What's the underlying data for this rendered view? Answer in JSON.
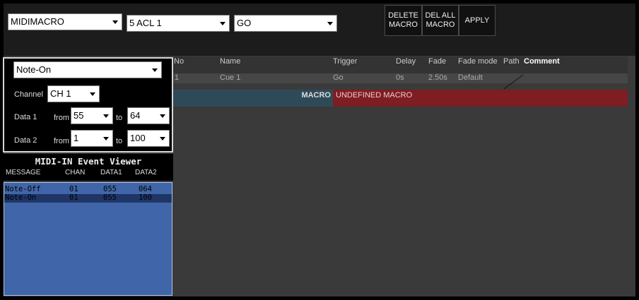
{
  "toolbar": {
    "macro_type": "MIDIMACRO",
    "cue_list": "5 ACL 1",
    "action": "GO",
    "delete_macro": "DELETE\nMACRO",
    "delete_all_macro": "DEL ALL\nMACRO",
    "apply": "APPLY"
  },
  "filter": {
    "message_type": "Note-On",
    "channel_label": "Channel",
    "channel_value": "CH 1",
    "data1_label": "Data 1",
    "data1_from_label": "from",
    "data1_from": "55",
    "data1_to_label": "to",
    "data1_to": "64",
    "data2_label": "Data 2",
    "data2_from_label": "from",
    "data2_from": "1",
    "data2_to_label": "to",
    "data2_to": "100"
  },
  "viewer": {
    "title": "MIDI-IN Event Viewer",
    "columns": [
      "MESSAGE",
      "CHAN",
      "DATA1",
      "DATA2"
    ],
    "events": [
      {
        "message": "Note-Off",
        "chan": "01",
        "data1": "055",
        "data2": "064"
      },
      {
        "message": "Note-On",
        "chan": "01",
        "data1": "055",
        "data2": "100"
      }
    ]
  },
  "cue_table": {
    "columns": {
      "no": "No",
      "name": "Name",
      "trigger": "Trigger",
      "delay": "Delay",
      "fade": "Fade",
      "fade_mode": "Fade mode",
      "path": "Path",
      "comment": "Comment"
    },
    "row": {
      "no": "1",
      "name": "Cue 1",
      "trigger": "Go",
      "delay": "0s",
      "fade": "2.50s",
      "fade_mode": "Default"
    },
    "macro_label": "MACRO",
    "macro_value": "UNDEFINED MACRO"
  },
  "colors": {
    "event_list_bg": "#4065a8",
    "event_selected_bg": "#1e3566",
    "macro_label_bg": "#2e4a58",
    "macro_value_bg": "#7e1e22"
  }
}
